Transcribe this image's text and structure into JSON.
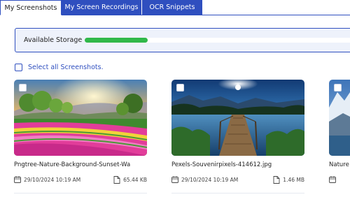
{
  "tabs": [
    {
      "label": "My Screenshots"
    },
    {
      "label": "My Screen Recordings"
    },
    {
      "label": "OCR Snippets"
    }
  ],
  "storage": {
    "label": "Available Storage",
    "used_fraction": 0.23,
    "bar_color": "#30b84a"
  },
  "select_all": {
    "label": "Select all Screenshots."
  },
  "screenshots": [
    {
      "title": "Pngtree-Nature-Background-Sunset-Wa",
      "date": "29/10/2024 10:19 AM",
      "size": "65.44 KB"
    },
    {
      "title": "Pexels-Souvenirpixels-414612.jpg",
      "date": "29/10/2024 10:19 AM",
      "size": "1.46 MB"
    },
    {
      "title": "Nature",
      "date": "",
      "size": ""
    }
  ],
  "icons": {
    "calendar": "calendar-icon",
    "file": "file-icon"
  },
  "colors": {
    "accent": "#2f4fbf",
    "storage_bg": "#eef2fb"
  }
}
